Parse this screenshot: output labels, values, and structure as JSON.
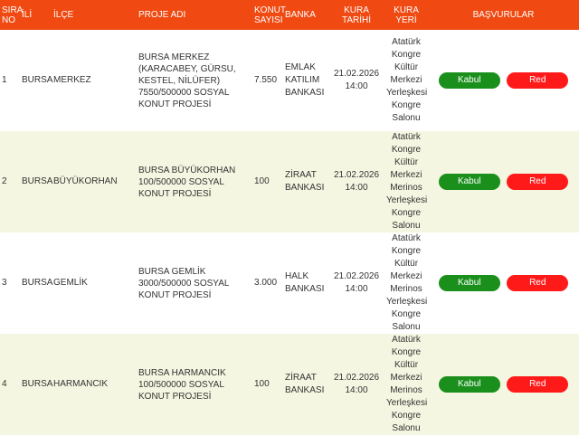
{
  "headers": {
    "sira_no": "SIRA NO",
    "ili": "İLİ",
    "ilce": "İLÇE",
    "proje_adi": "PROJE ADI",
    "konut_sayisi": "KONUT SAYISI",
    "banka": "BANKA",
    "kura_tarihi": "KURA TARİHİ",
    "kura_yeri": "KURA YERİ",
    "basvurular": "BAŞVURULAR"
  },
  "buttons": {
    "kabul": "Kabul",
    "red": "Red"
  },
  "rows": [
    {
      "sira": "1",
      "il": "BURSA",
      "ilce": "MERKEZ",
      "proje": "BURSA MERKEZ (KARACABEY, GÜRSU, KESTEL, NİLÜFER) 7550/500000 SOSYAL KONUT PROJESİ",
      "konut": "7.550",
      "banka": "EMLAK KATILIM BANKASI",
      "tarih": "21.02.2026 14:00",
      "yeri": "Atatürk Kongre Kültür Merkezi Yerleşkesi Kongre Salonu"
    },
    {
      "sira": "2",
      "il": "BURSA",
      "ilce": "BÜYÜKORHAN",
      "proje": "BURSA BÜYÜKORHAN 100/500000 SOSYAL KONUT PROJESİ",
      "konut": "100",
      "banka": "ZİRAAT BANKASI",
      "tarih": "21.02.2026 14:00",
      "yeri": "Atatürk Kongre Kültür Merkezi Merinos Yerleşkesi Kongre Salonu"
    },
    {
      "sira": "3",
      "il": "BURSA",
      "ilce": "GEMLİK",
      "proje": "BURSA GEMLİK 3000/500000 SOSYAL KONUT PROJESİ",
      "konut": "3.000",
      "banka": "HALK BANKASI",
      "tarih": "21.02.2026 14:00",
      "yeri": "Atatürk Kongre Kültür Merkezi Merinos Yerleşkesi Kongre Salonu"
    },
    {
      "sira": "4",
      "il": "BURSA",
      "ilce": "HARMANCIK",
      "proje": "BURSA HARMANCIK 100/500000 SOSYAL KONUT PROJESİ",
      "konut": "100",
      "banka": "ZİRAAT BANKASI",
      "tarih": "21.02.2026 14:00",
      "yeri": "Atatürk Kongre Kültür Merkezi Merinos Yerleşkesi Kongre Salonu"
    }
  ]
}
